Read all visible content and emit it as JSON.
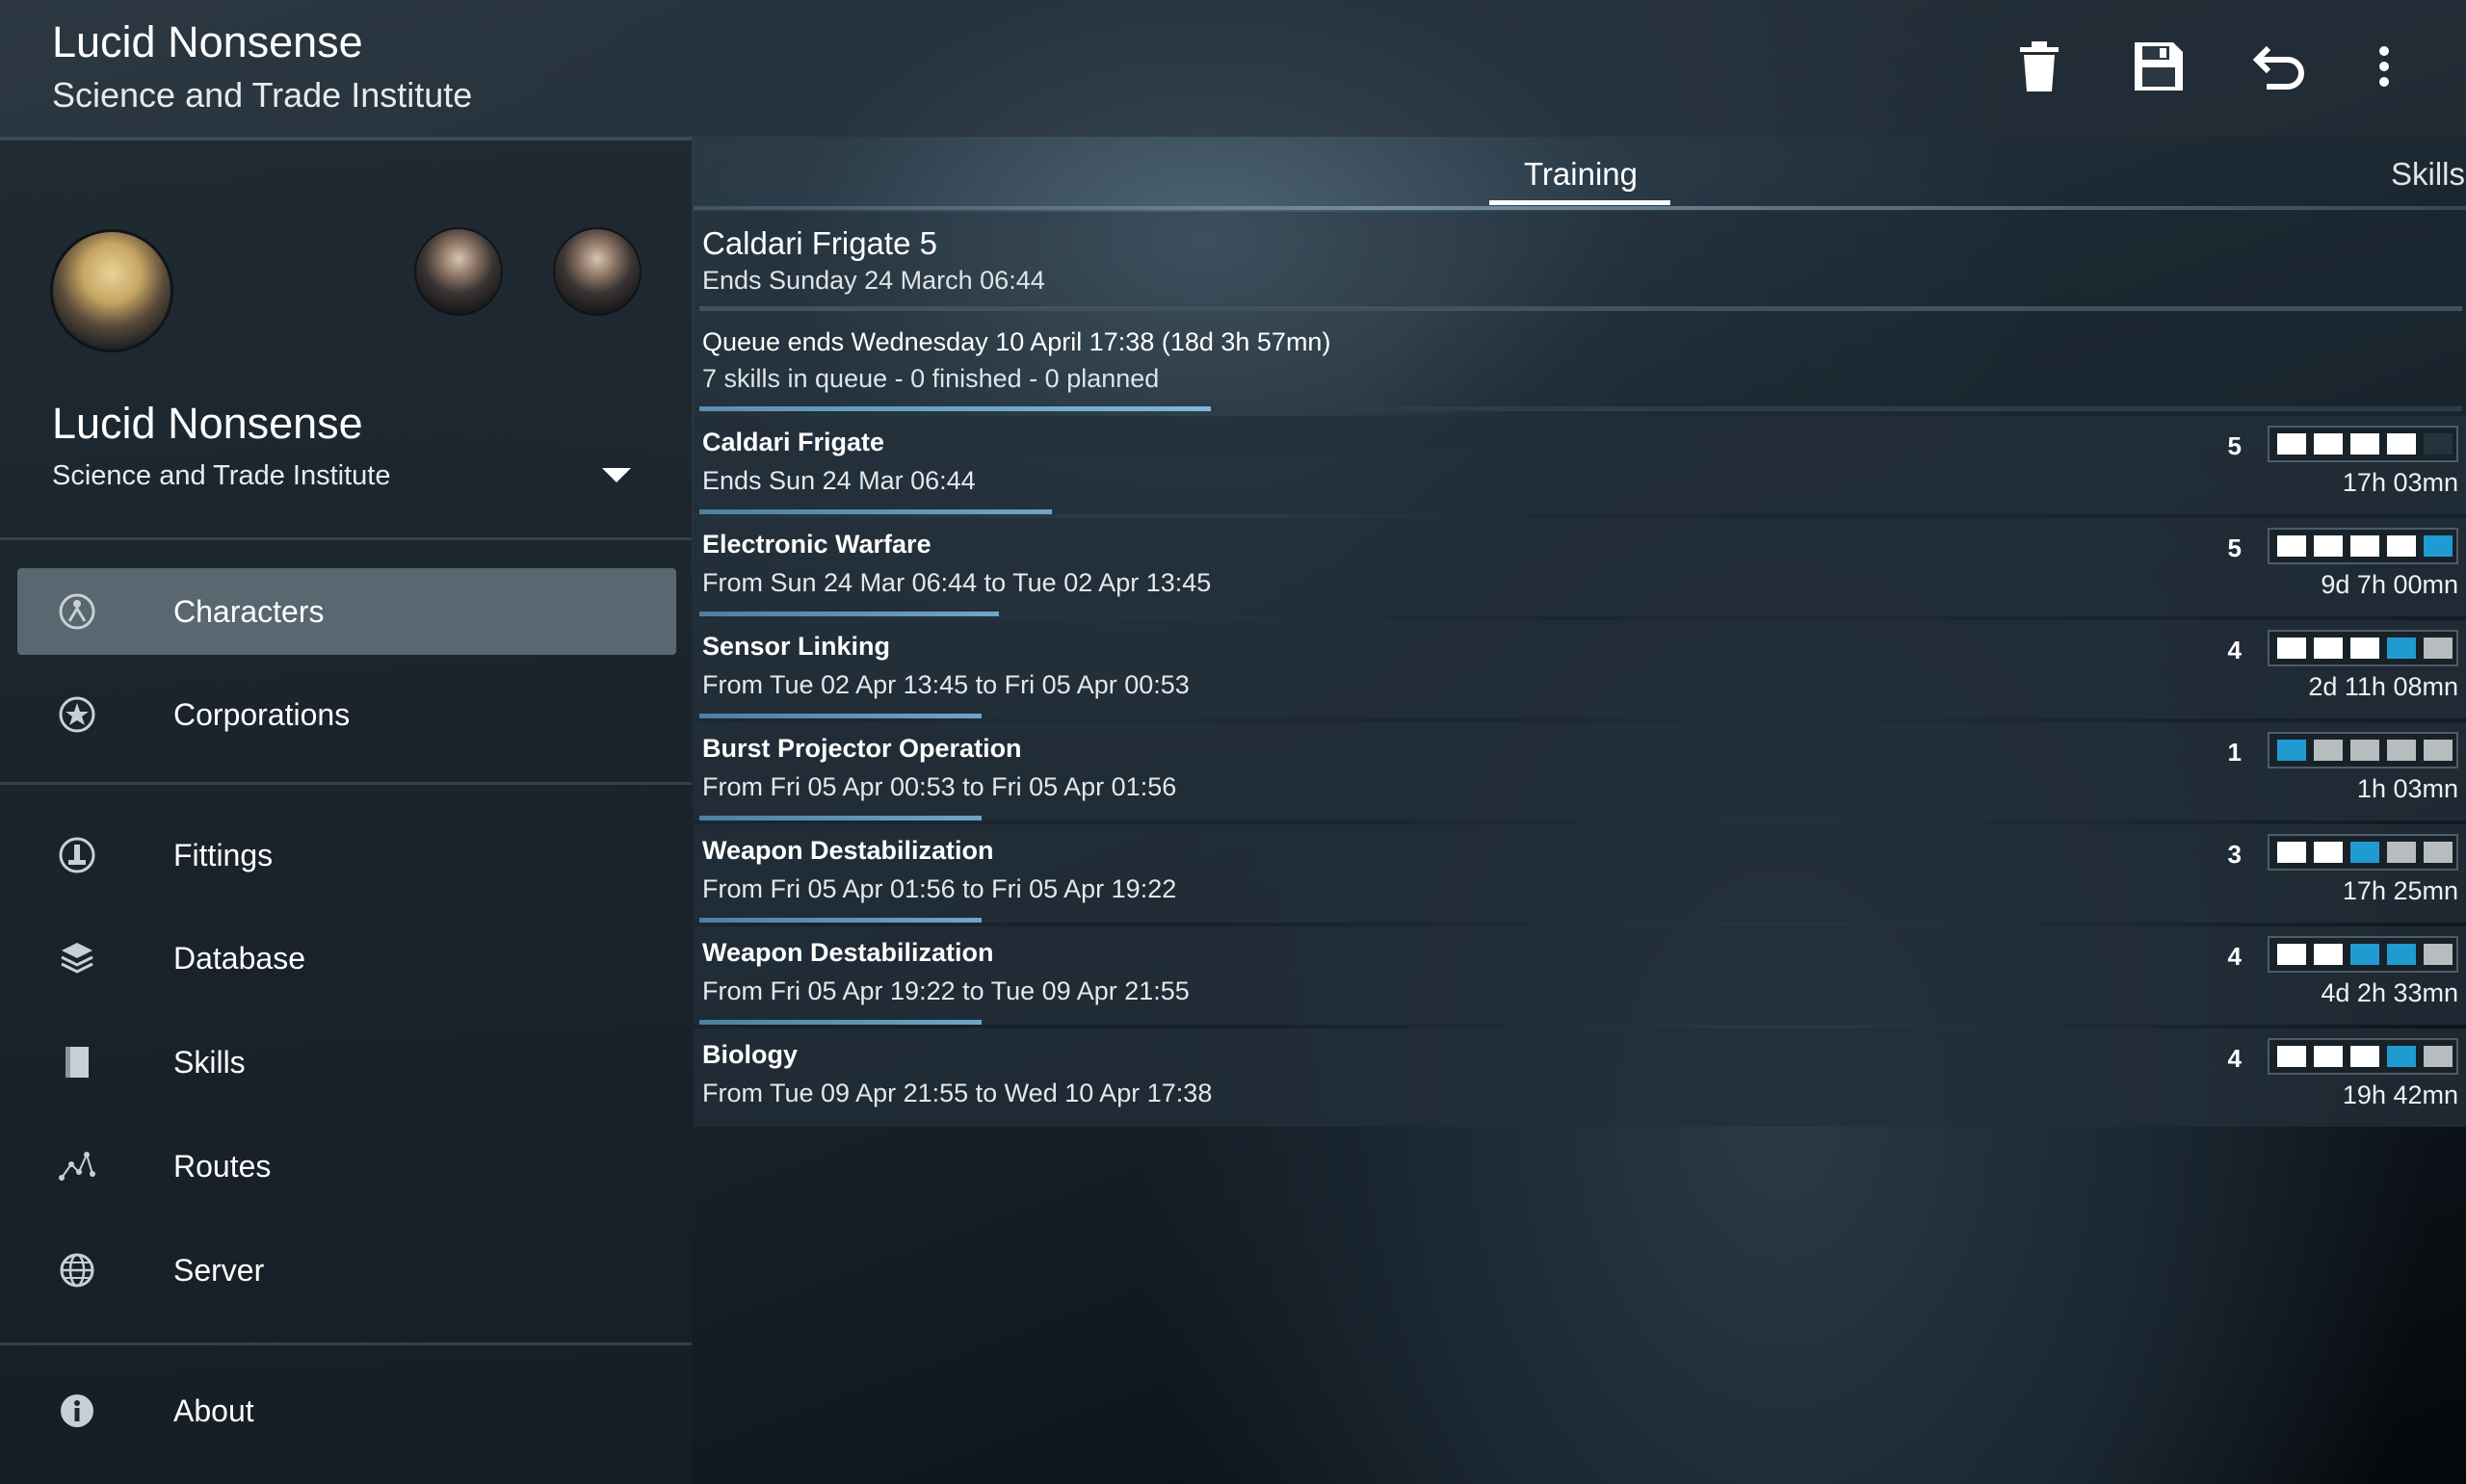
{
  "app": {
    "title": "Lucid Nonsense",
    "subtitle": "Science and Trade Institute"
  },
  "toolbar": {
    "icons": [
      "trash-icon",
      "save-icon",
      "undo-icon",
      "more-vert-icon"
    ]
  },
  "sidebar": {
    "character_name": "Lucid Nonsense",
    "character_corp": "Science and Trade Institute",
    "nav": [
      {
        "label": "Characters",
        "icon": "characters-icon",
        "active": true
      },
      {
        "label": "Corporations",
        "icon": "corporations-icon",
        "active": false
      },
      {
        "label": "Fittings",
        "icon": "fittings-icon",
        "active": false
      },
      {
        "label": "Database",
        "icon": "database-icon",
        "active": false
      },
      {
        "label": "Skills",
        "icon": "skills-icon",
        "active": false
      },
      {
        "label": "Routes",
        "icon": "routes-icon",
        "active": false
      },
      {
        "label": "Server",
        "icon": "server-icon",
        "active": false
      },
      {
        "label": "About",
        "icon": "about-icon",
        "active": false
      }
    ]
  },
  "tabs": {
    "training": "Training",
    "skills": "Skills",
    "active": "training"
  },
  "current": {
    "title": "Caldari Frigate 5",
    "ends": "Ends Sunday 24 March 06:44"
  },
  "queue": {
    "ends": "Queue ends Wednesday 10 April 17:38 (18d 3h 57mn)",
    "summary": "7 skills in queue - 0 finished - 0 planned",
    "progress": 0.29
  },
  "colors": {
    "trained": "#ffffff",
    "queued": "#1f9bd2",
    "not_trained": "#b7bcbf",
    "accent": "#6fa5c6"
  },
  "skills": [
    {
      "name": "Caldari Frigate",
      "time": "Ends Sun 24 Mar 06:44",
      "level": "5",
      "levels": [
        "t",
        "t",
        "t",
        "t",
        "e"
      ],
      "duration": "17h 03mn",
      "progress": 0.2
    },
    {
      "name": "Electronic Warfare",
      "time": "From Sun 24 Mar 06:44 to Tue 02 Apr 13:45",
      "level": "5",
      "levels": [
        "t",
        "t",
        "t",
        "t",
        "q"
      ],
      "duration": "9d 7h 00mn",
      "progress": 0.17
    },
    {
      "name": "Sensor Linking",
      "time": "From Tue 02 Apr 13:45 to Fri 05 Apr 00:53",
      "level": "4",
      "levels": [
        "t",
        "t",
        "t",
        "q",
        "n"
      ],
      "duration": "2d 11h 08mn",
      "progress": 0.16
    },
    {
      "name": "Burst Projector Operation",
      "time": "From Fri 05 Apr 00:53 to Fri 05 Apr 01:56",
      "level": "1",
      "levels": [
        "q",
        "n",
        "n",
        "n",
        "n"
      ],
      "duration": "1h 03mn",
      "progress": 0.16
    },
    {
      "name": "Weapon Destabilization",
      "time": "From Fri 05 Apr 01:56 to Fri 05 Apr 19:22",
      "level": "3",
      "levels": [
        "t",
        "t",
        "q",
        "n",
        "n"
      ],
      "duration": "17h 25mn",
      "progress": 0.16
    },
    {
      "name": "Weapon Destabilization",
      "time": "From Fri 05 Apr 19:22 to Tue 09 Apr 21:55",
      "level": "4",
      "levels": [
        "t",
        "t",
        "q",
        "q",
        "n"
      ],
      "duration": "4d 2h 33mn",
      "progress": 0.16
    },
    {
      "name": "Biology",
      "time": "From Tue 09 Apr 21:55 to Wed 10 Apr 17:38",
      "level": "4",
      "levels": [
        "t",
        "t",
        "t",
        "q",
        "n"
      ],
      "duration": "19h 42mn",
      "progress": 0
    }
  ]
}
